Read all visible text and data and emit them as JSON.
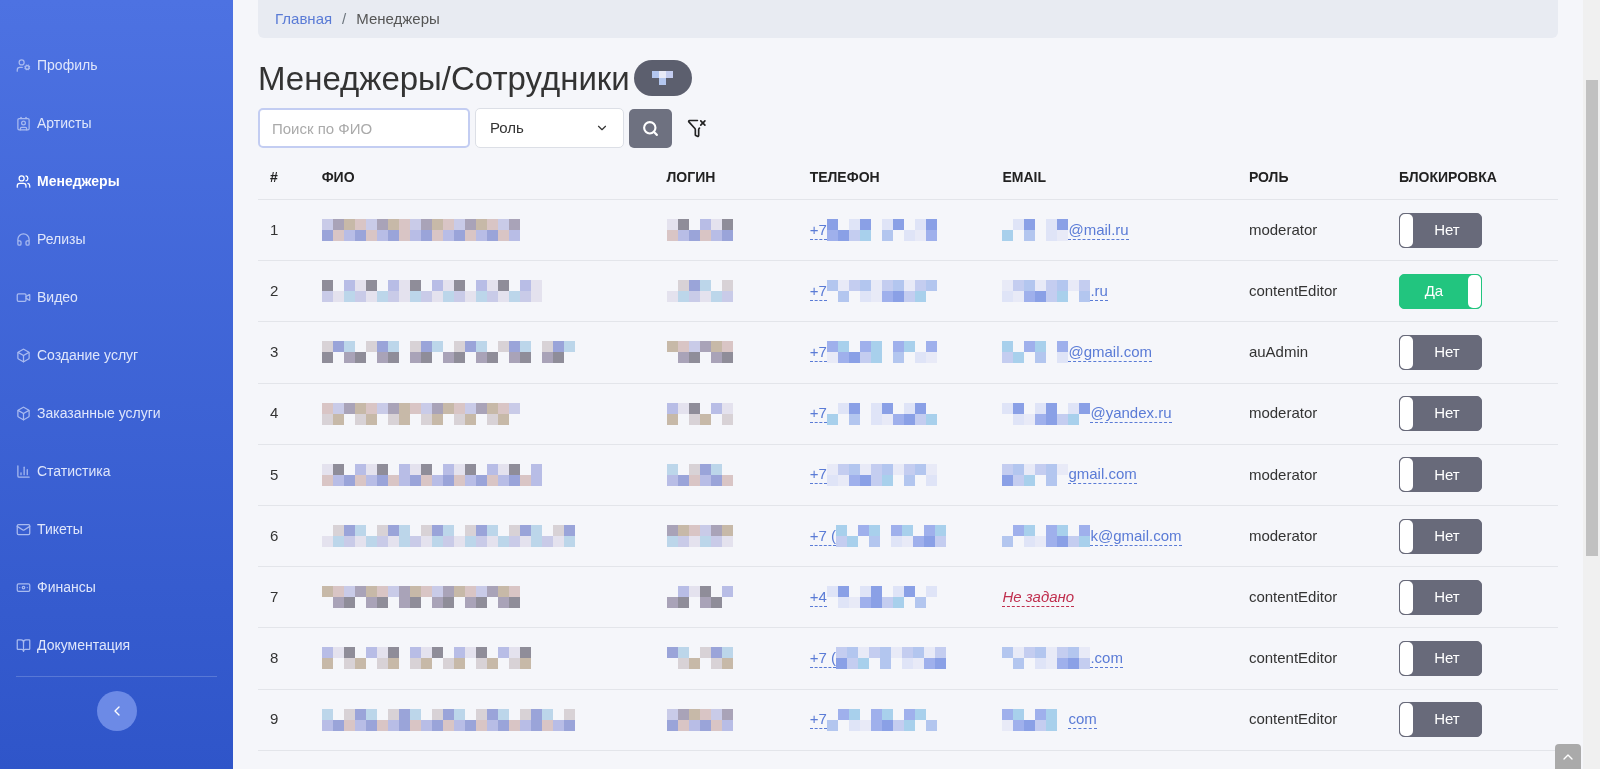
{
  "sidebar": {
    "items": [
      {
        "label": "Профиль",
        "selected": false
      },
      {
        "label": "Артисты",
        "selected": false
      },
      {
        "label": "Менеджеры",
        "selected": true
      },
      {
        "label": "Релизы",
        "selected": false
      },
      {
        "label": "Видео",
        "selected": false
      },
      {
        "label": "Создание услуг",
        "selected": false
      },
      {
        "label": "Заказанные услуги",
        "selected": false
      },
      {
        "label": "Статистика",
        "selected": false
      },
      {
        "label": "Тикеты",
        "selected": false
      },
      {
        "label": "Финансы",
        "selected": false
      },
      {
        "label": "Документация",
        "selected": false
      }
    ]
  },
  "breadcrumb": {
    "separator": "/",
    "items": [
      "Главная",
      "Менеджеры"
    ]
  },
  "title": "Менеджеры/Сотрудники",
  "filters": {
    "search_placeholder": "Поиск по ФИО",
    "role_select": "Роль"
  },
  "table": {
    "columns": [
      "#",
      "ФИО",
      "ЛОГИН",
      "ТЕЛЕФОН",
      "EMAIL",
      "РОЛЬ",
      "БЛОКИРОВКА"
    ],
    "rows": [
      {
        "num": "1",
        "phone": "+7",
        "email": {
          "kind": "link",
          "text": "@mail.ru"
        },
        "role": "moderator",
        "blocked": false,
        "block_label": "Нет"
      },
      {
        "num": "2",
        "phone": "+7",
        "email": {
          "kind": "link",
          "text": ".ru"
        },
        "role": "contentEditor",
        "blocked": true,
        "block_label": "Да"
      },
      {
        "num": "3",
        "phone": "+7",
        "email": {
          "kind": "link",
          "text": "@gmail.com"
        },
        "role": "auAdmin",
        "blocked": false,
        "block_label": "Нет"
      },
      {
        "num": "4",
        "phone": "+7",
        "email": {
          "kind": "link",
          "text": "@yandex.ru"
        },
        "role": "moderator",
        "blocked": false,
        "block_label": "Нет"
      },
      {
        "num": "5",
        "phone": "+7",
        "email": {
          "kind": "link",
          "text": "gmail.com"
        },
        "role": "moderator",
        "blocked": false,
        "block_label": "Нет"
      },
      {
        "num": "6",
        "phone": "+7 (",
        "email": {
          "kind": "link",
          "text": "k@gmail.com"
        },
        "role": "moderator",
        "blocked": false,
        "block_label": "Нет"
      },
      {
        "num": "7",
        "phone": "+4",
        "email": {
          "kind": "unset",
          "text": "Не задано"
        },
        "role": "contentEditor",
        "blocked": false,
        "block_label": "Нет"
      },
      {
        "num": "8",
        "phone": "+7 (",
        "email": {
          "kind": "link",
          "text": ".com"
        },
        "role": "contentEditor",
        "blocked": false,
        "block_label": "Нет"
      },
      {
        "num": "9",
        "phone": "+7",
        "email": {
          "kind": "link",
          "text": "com"
        },
        "role": "contentEditor",
        "blocked": false,
        "block_label": "Нет"
      }
    ]
  }
}
